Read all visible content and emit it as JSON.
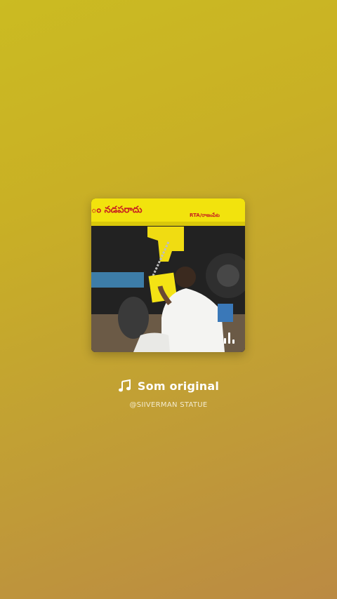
{
  "audio": {
    "title": "Som original",
    "artist": "@SIIVERMAN STATUE",
    "note_icon": "music-note-icon",
    "playing_icon": "equalizer-bars-icon"
  },
  "cover": {
    "sign_text_left": "ం నడపరాదు",
    "sign_text_right": "RTA/రాజంపేట",
    "truck_color": "#f2e30d"
  },
  "colors": {
    "background_top": "#cbbb22",
    "background_bottom": "#bb8a43",
    "text": "#ffffff"
  }
}
